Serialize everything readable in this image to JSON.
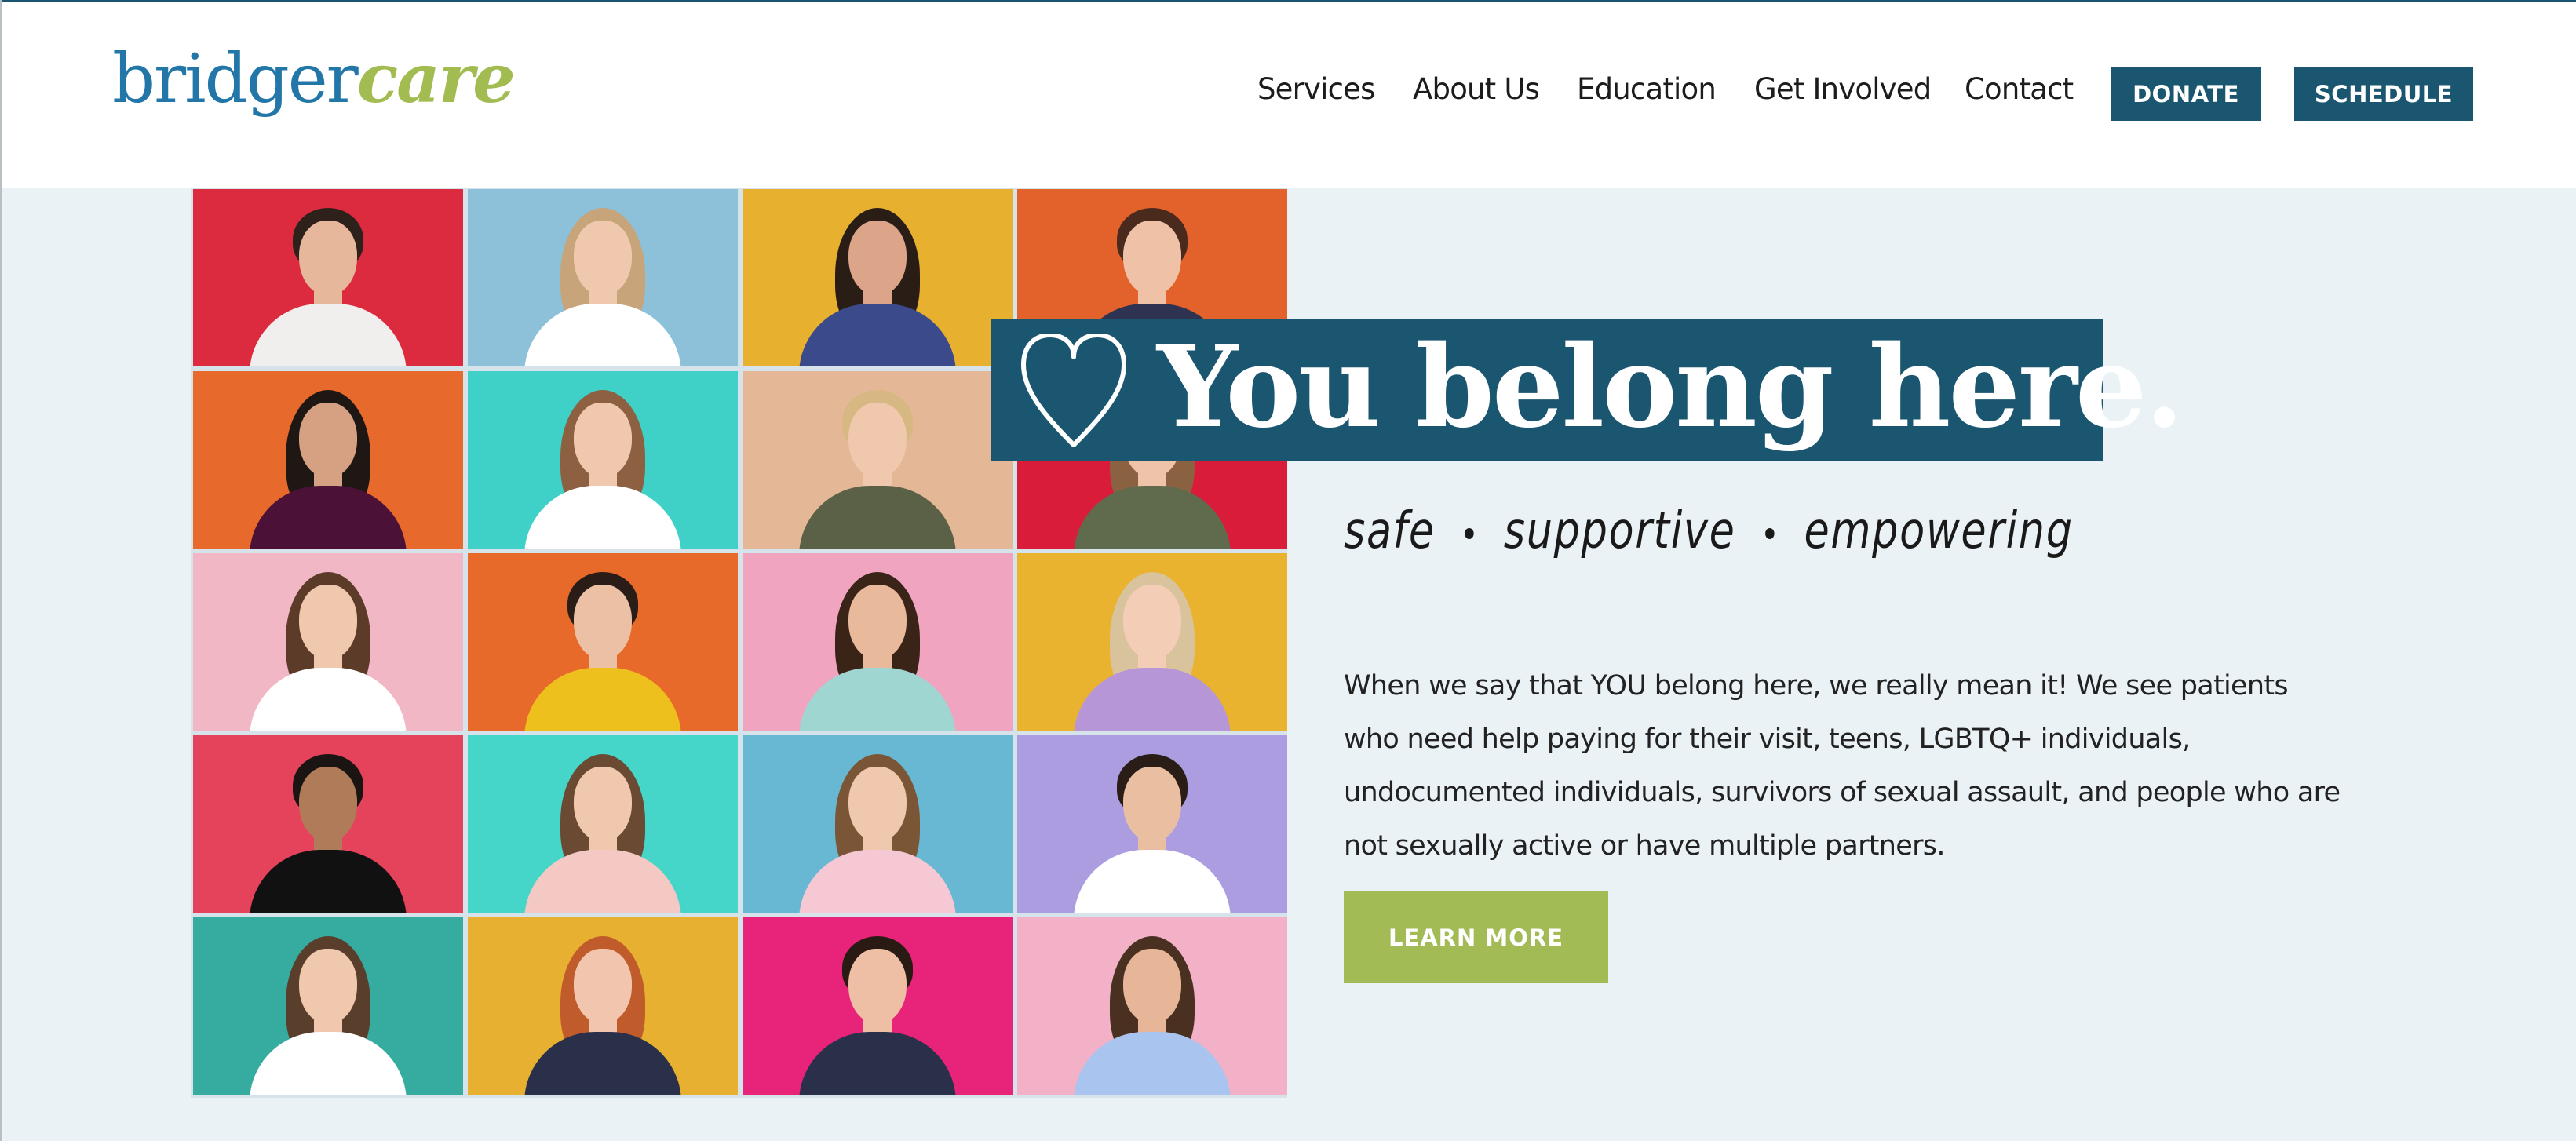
{
  "brand": {
    "logo_part1": "bridger",
    "logo_part2": "care",
    "colors": {
      "primary": "#1b5670",
      "logo_blue": "#2277a8",
      "accent_green": "#a3bb55",
      "page_bg": "#eaf2f6"
    }
  },
  "nav": {
    "items": [
      {
        "label": "Services"
      },
      {
        "label": "About Us"
      },
      {
        "label": "Education"
      },
      {
        "label": "Get Involved"
      },
      {
        "label": "Contact"
      }
    ],
    "donate_label": "DONATE",
    "schedule_label": "SCHEDULE"
  },
  "hero": {
    "heart_icon": "heart-outline-icon",
    "headline": "You belong here.",
    "tagline": [
      "safe",
      "supportive",
      "empowering"
    ],
    "body": "When we say that YOU belong here, we really mean it! We see patients who need help paying for their visit, teens, LGBTQ+ individuals, undocumented individuals, survivors of sexual assault, and people who are not sexually active or have multiple partners.",
    "cta_label": "LEARN MORE"
  },
  "photo_grid": {
    "tiles": [
      {
        "bg": "#dc2a3e",
        "skin": "#e6b79b",
        "hair": "#2e211b",
        "shirt": "#f1eeee"
      },
      {
        "bg": "#8cc1d9",
        "skin": "#f0c8ad",
        "hair": "#c7a47a",
        "shirt": "#ffffff"
      },
      {
        "bg": "#e8b02f",
        "skin": "#dca58a",
        "hair": "#2a1d16",
        "shirt": "#3a4a8a"
      },
      {
        "bg": "#e3612a",
        "skin": "#efc1a6",
        "hair": "#4a2a1d",
        "shirt": "#2d3350"
      },
      {
        "bg": "#e76a2c",
        "skin": "#d6a083",
        "hair": "#1e1714",
        "shirt": "#4b1136"
      },
      {
        "bg": "#3fd1c7",
        "skin": "#f0c8ad",
        "hair": "#8c6040",
        "shirt": "#ffffff"
      },
      {
        "bg": "#e4b896",
        "skin": "#f0c8ad",
        "hair": "#d8b882",
        "shirt": "#5a6146"
      },
      {
        "bg": "#d81c3a",
        "skin": "#eec3aa",
        "hair": "#8a6242",
        "shirt": "#5f6b4c"
      },
      {
        "bg": "#f2b7c5",
        "skin": "#f0c8ad",
        "hair": "#5c3b29",
        "shirt": "#ffffff"
      },
      {
        "bg": "#e86a2a",
        "skin": "#ecc0a4",
        "hair": "#2a1c16",
        "shirt": "#edc01e"
      },
      {
        "bg": "#f0a4bf",
        "skin": "#e9b99c",
        "hair": "#3a2418",
        "shirt": "#9fd6d2"
      },
      {
        "bg": "#e9b22f",
        "skin": "#f3cdb6",
        "hair": "#d9c39d",
        "shirt": "#b796d8"
      },
      {
        "bg": "#e5425c",
        "skin": "#b07b58",
        "hair": "#1a1412",
        "shirt": "#111111"
      },
      {
        "bg": "#46d6c9",
        "skin": "#f0c8ad",
        "hair": "#6a4a32",
        "shirt": "#f4c9c4"
      },
      {
        "bg": "#68b8d3",
        "skin": "#f0c8ad",
        "hair": "#7a5636",
        "shirt": "#f6c8d4"
      },
      {
        "bg": "#ab9de0",
        "skin": "#eabea0",
        "hair": "#2a1c16",
        "shirt": "#ffffff"
      },
      {
        "bg": "#36ab9f",
        "skin": "#f0c8ad",
        "hair": "#5a3e2c",
        "shirt": "#ffffff"
      },
      {
        "bg": "#e8b030",
        "skin": "#f2c6ae",
        "hair": "#c05c2c",
        "shirt": "#2a2f4a"
      },
      {
        "bg": "#e8237a",
        "skin": "#eebfa4",
        "hair": "#2a1a14",
        "shirt": "#2a2f4a"
      },
      {
        "bg": "#f2b1c6",
        "skin": "#e7b597",
        "hair": "#4a3020",
        "shirt": "#a8c4ef"
      }
    ]
  }
}
